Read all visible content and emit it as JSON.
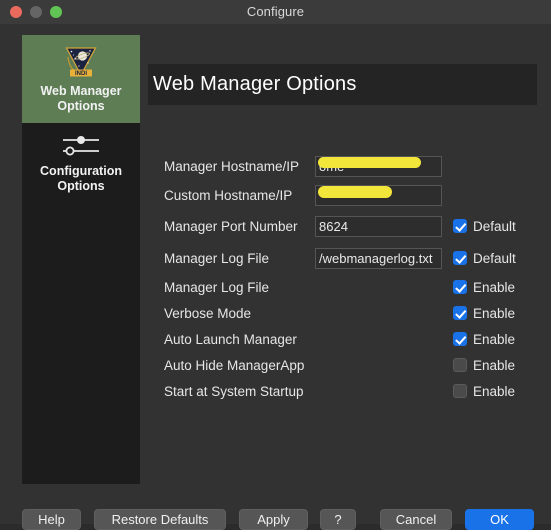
{
  "window": {
    "title": "Configure",
    "traffic_lights": [
      "close-button",
      "minimize-button",
      "zoom-button"
    ]
  },
  "sidebar": {
    "items": [
      {
        "id": "web-manager-options",
        "label_line1": "Web Manager",
        "label_line2": "Options",
        "icon": "indi-logo-icon",
        "selected": true,
        "selected_color": "#5e7d55"
      },
      {
        "id": "configuration-options",
        "label_line1": "Configuration",
        "label_line2": "Options",
        "icon": "sliders-icon",
        "selected": false
      }
    ]
  },
  "header": {
    "title": "Web Manager Options"
  },
  "form": {
    "rows": [
      {
        "id": "manager-hostname-ip",
        "label": "Manager Hostname/IP",
        "value": "ome",
        "redacted": true,
        "has_checkbox": false
      },
      {
        "id": "custom-hostname-ip",
        "label": "Custom Hostname/IP",
        "value": "",
        "redacted": true,
        "has_checkbox": false
      },
      {
        "id": "manager-port-number",
        "label": "Manager Port Number",
        "value": "8624",
        "redacted": false,
        "has_checkbox": true,
        "checkbox_label": "Default",
        "checked": true
      },
      {
        "id": "manager-log-file-path",
        "label": "Manager Log File",
        "value": "/webmanagerlog.txt",
        "redacted": false,
        "has_checkbox": true,
        "checkbox_label": "Default",
        "checked": true
      }
    ],
    "toggles": [
      {
        "id": "manager-log-file",
        "label": "Manager Log File",
        "checkbox_label": "Enable",
        "checked": true
      },
      {
        "id": "verbose-mode",
        "label": "Verbose Mode",
        "checkbox_label": "Enable",
        "checked": true
      },
      {
        "id": "auto-launch-manager",
        "label": "Auto Launch Manager",
        "checkbox_label": "Enable",
        "checked": true
      },
      {
        "id": "auto-hide-managerapp",
        "label": "Auto Hide ManagerApp",
        "checkbox_label": "Enable",
        "checked": false
      },
      {
        "id": "start-at-system-startup",
        "label": "Start at System Startup",
        "checkbox_label": "Enable",
        "checked": false
      }
    ]
  },
  "buttons": {
    "help": "Help",
    "restore_defaults": "Restore Defaults",
    "apply": "Apply",
    "question": "?",
    "cancel": "Cancel",
    "ok": "OK"
  },
  "colors": {
    "accent_blue": "#1a72e8",
    "selected_green": "#5e7d55",
    "redaction_yellow": "#f2e63a",
    "window_bg": "#323232",
    "sidebar_bg": "#1c1c1c",
    "titlebar_bg": "#3b3b3b"
  }
}
